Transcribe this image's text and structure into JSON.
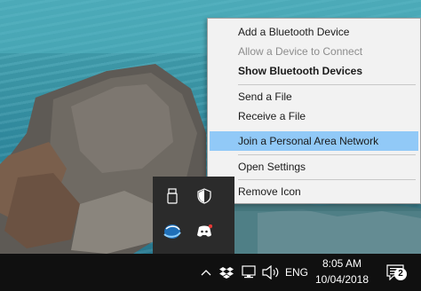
{
  "context_menu": {
    "items": [
      {
        "label": "Add a Bluetooth Device",
        "state": "normal"
      },
      {
        "label": "Allow a Device to Connect",
        "state": "disabled"
      },
      {
        "label": "Show Bluetooth Devices",
        "state": "bold"
      },
      {
        "label": "Send a File",
        "state": "normal"
      },
      {
        "label": "Receive a File",
        "state": "normal"
      },
      {
        "label": "Join a Personal Area Network",
        "state": "highlighted"
      },
      {
        "label": "Open Settings",
        "state": "normal"
      },
      {
        "label": "Remove Icon",
        "state": "normal"
      }
    ],
    "highlight_color": "#91c9f7"
  },
  "tray_flyout": {
    "icons": [
      "usb-drive-icon",
      "shield-icon",
      "bluetooth-tray-icon",
      "discord-icon"
    ]
  },
  "taskbar": {
    "icons": [
      "chevron-up-icon",
      "dropbox-icon",
      "network-icon",
      "volume-icon"
    ],
    "language": "ENG",
    "time": "8:05 AM",
    "date": "10/04/2018",
    "notification_count": "2"
  }
}
